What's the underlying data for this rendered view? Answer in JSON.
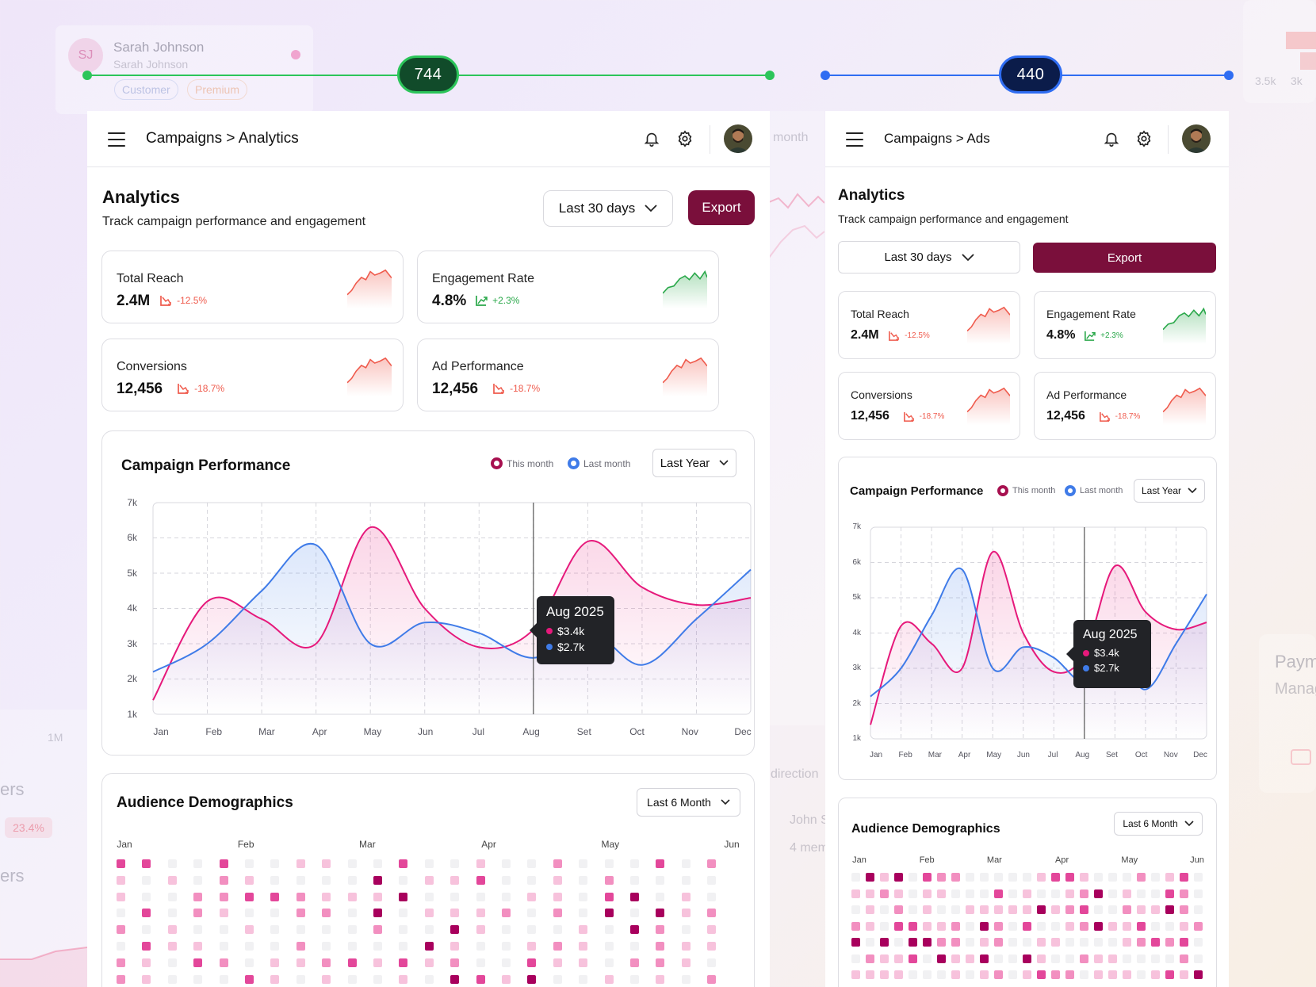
{
  "colors": {
    "brand": "#7a0f3b",
    "this_month": "#e6197b",
    "last_month": "#3f7be8",
    "up": "#2aa84a",
    "down": "#ef5b4d",
    "green_measure": "#2cc55a",
    "blue_measure": "#2f6df2"
  },
  "background": {
    "ghost_initials": "SJ",
    "ghost_name": "Sarah Johnson",
    "ghost_sub": "Sarah Johnson",
    "ghost_chip_customer": "Customer",
    "ghost_chip_premium": "Premium",
    "ghost_month": "month",
    "ghost_direction": "direction",
    "ghost_john": "John S",
    "ghost_members": "4 mem",
    "ghost_1m": "1M",
    "ghost_ers1": "ers",
    "ghost_pct": "23.4%",
    "ghost_ers2": "ers",
    "ghost_35k": "3.5k",
    "ghost_3k": "3k",
    "ghost_paym": "Paym",
    "ghost_manag": "Manag"
  },
  "measure_left": {
    "value": "744"
  },
  "measure_right": {
    "value": "440"
  },
  "left": {
    "breadcrumb": "Campaigns > Analytics",
    "title": "Analytics",
    "subtitle": "Track campaign performance and engagement",
    "range": "Last 30 days",
    "export": "Export",
    "kpis": [
      {
        "label": "Total Reach",
        "value": "2.4M",
        "delta": "-12.5%",
        "trend": "down"
      },
      {
        "label": "Engagement Rate",
        "value": "4.8%",
        "delta": "+2.3%",
        "trend": "up"
      },
      {
        "label": "Conversions",
        "value": "12,456",
        "delta": "-18.7%",
        "trend": "down"
      },
      {
        "label": "Ad Performance",
        "value": "12,456",
        "delta": "-18.7%",
        "trend": "down"
      }
    ],
    "performance": {
      "title": "Campaign Performance",
      "legend_this": "This month",
      "legend_last": "Last month",
      "period": "Last Year",
      "tooltip": {
        "title": "Aug 2025",
        "this": "$3.4k",
        "last": "$2.7k"
      }
    },
    "demographics": {
      "title": "Audience Demographics",
      "period": "Last 6 Month",
      "months": [
        "Jan",
        "Feb",
        "Mar",
        "Apr",
        "May",
        "Jun"
      ]
    }
  },
  "right": {
    "breadcrumb": "Campaigns > Ads",
    "title": "Analytics",
    "subtitle": "Track campaign performance and engagement",
    "range": "Last 30 days",
    "export": "Export",
    "kpis": [
      {
        "label": "Total Reach",
        "value": "2.4M",
        "delta": "-12.5%",
        "trend": "down"
      },
      {
        "label": "Engagement Rate",
        "value": "4.8%",
        "delta": "+2.3%",
        "trend": "up"
      },
      {
        "label": "Conversions",
        "value": "12,456",
        "delta": "-18.7%",
        "trend": "down"
      },
      {
        "label": "Ad Performance",
        "value": "12,456",
        "delta": "-18.7%",
        "trend": "down"
      }
    ],
    "performance": {
      "title": "Campaign Performance",
      "legend_this": "This month",
      "legend_last": "Last month",
      "period": "Last Year",
      "tooltip": {
        "title": "Aug 2025",
        "this": "$3.4k",
        "last": "$2.7k"
      }
    },
    "demographics": {
      "title": "Audience Demographics",
      "period": "Last 6 Month",
      "months": [
        "Jan",
        "Feb",
        "Mar",
        "Apr",
        "May",
        "Jun"
      ]
    }
  },
  "chart_data": [
    {
      "type": "area",
      "title": "Campaign Performance",
      "categories": [
        "Jan",
        "Feb",
        "Mar",
        "Apr",
        "May",
        "Jun",
        "Jul",
        "Aug",
        "Set",
        "Oct",
        "Nov",
        "Dec"
      ],
      "ylim": [
        1000,
        7000
      ],
      "yticks": [
        "7k",
        "6k",
        "5k",
        "4k",
        "3k",
        "2k",
        "1k"
      ],
      "series": [
        {
          "name": "This month",
          "values": [
            1400,
            4200,
            3700,
            3000,
            6300,
            4000,
            2900,
            3400,
            5900,
            4600,
            4100,
            4300
          ]
        },
        {
          "name": "Last month",
          "values": [
            2200,
            3000,
            4500,
            5800,
            3000,
            3600,
            3300,
            2600,
            3400,
            2400,
            3700,
            5100
          ]
        }
      ],
      "highlight": {
        "category": "Aug",
        "label": "Aug 2025",
        "this": "$3.4k",
        "last": "$2.7k"
      }
    }
  ]
}
